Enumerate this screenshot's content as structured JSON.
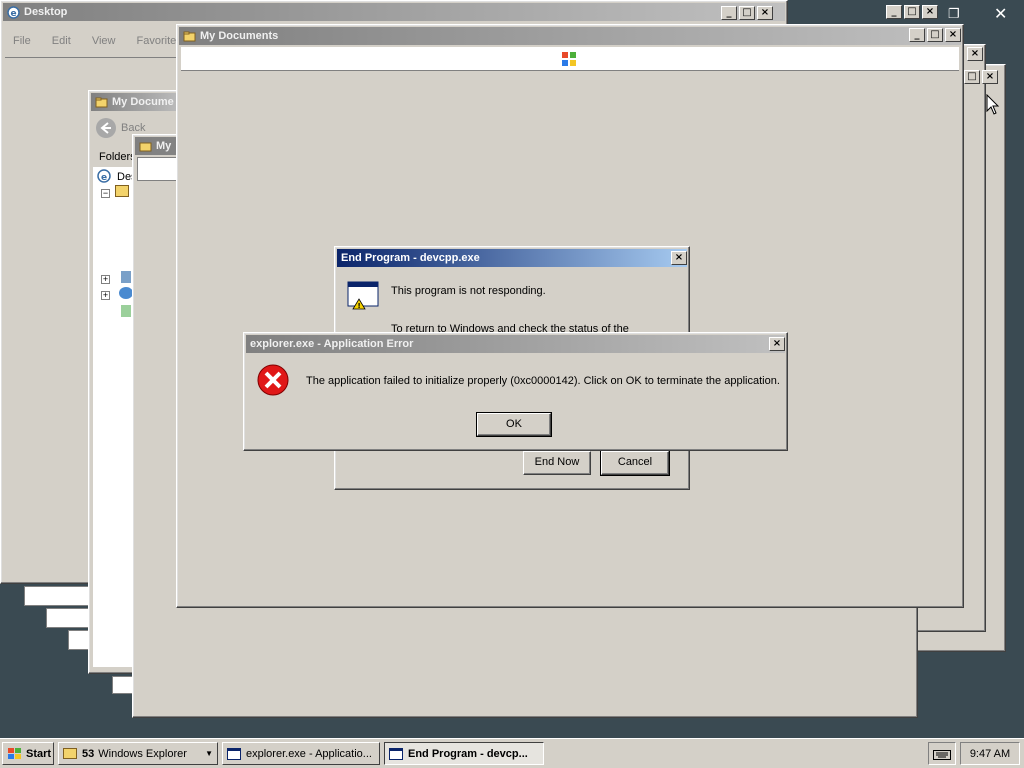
{
  "desktop_window": {
    "title": "Desktop",
    "menu": [
      "File",
      "Edit",
      "View",
      "Favorites"
    ]
  },
  "my_documents_back": {
    "title": "My Docume",
    "back_label": "Back",
    "folders_label": "Folders",
    "tree_desktop": "Des"
  },
  "my_documents_small": {
    "title": "My"
  },
  "my_documents_main": {
    "title": "My Documents"
  },
  "end_program_dialog": {
    "title": "End Program - devcpp.exe",
    "message": "This program is not responding.",
    "message2": "To return to Windows and check the status of the",
    "end_now": "End Now",
    "cancel": "Cancel"
  },
  "error_dialog": {
    "title": "explorer.exe - Application Error",
    "message": "The application failed to initialize properly (0xc0000142). Click on OK to terminate the application.",
    "ok": "OK"
  },
  "taskbar": {
    "start": "Start",
    "group_count": "53",
    "group_label": "Windows Explorer",
    "task1": "explorer.exe - Applicatio...",
    "task2": "End Program - devcp...",
    "clock": "9:47 AM"
  },
  "icons": {
    "ie": "ie-icon",
    "folder": "folder-icon",
    "error": "error-icon",
    "warning_window": "warning-window-icon",
    "windows_logo": "windows-logo-icon"
  }
}
